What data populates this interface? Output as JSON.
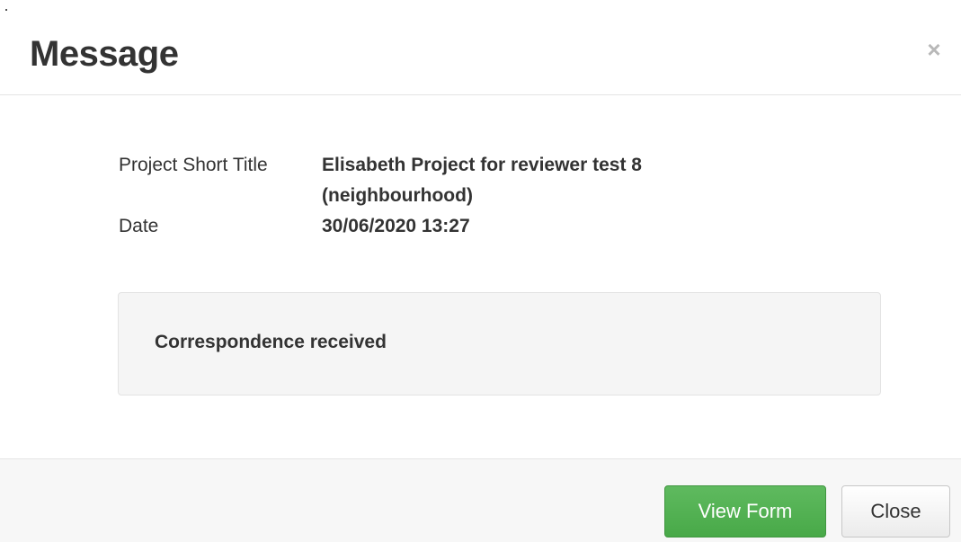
{
  "dialog": {
    "title": "Message",
    "close_icon": "close-icon"
  },
  "details": {
    "project_label": "Project Short Title",
    "project_value": "Elisabeth Project for reviewer test 8 (neighbourhood)",
    "date_label": "Date",
    "date_value": "30/06/2020 13:27"
  },
  "message": {
    "text": "Correspondence received"
  },
  "footer": {
    "view_form_label": "View Form",
    "close_label": "Close"
  },
  "colors": {
    "primary_button": "#5cb85c",
    "footer_background": "#f7f7f7",
    "well_background": "#f5f5f5"
  }
}
